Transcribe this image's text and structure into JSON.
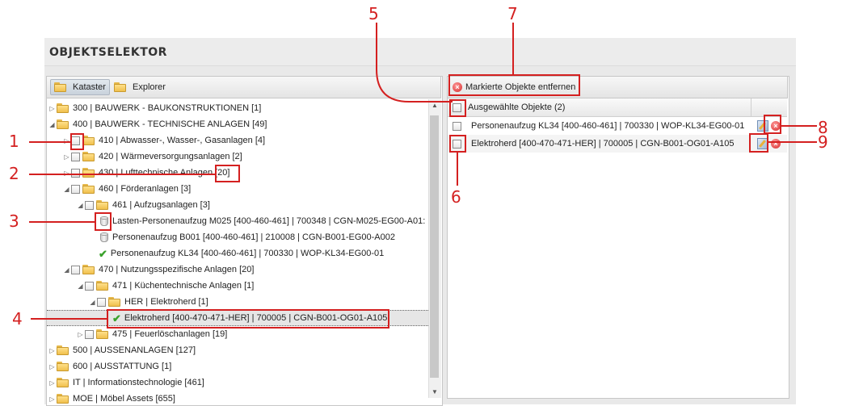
{
  "panel": {
    "title": "OBJEKTSELEKTOR"
  },
  "left": {
    "toolbar": {
      "kataster_label": "Kataster",
      "explorer_label": "Explorer"
    },
    "tree": [
      {
        "label": "300 | BAUWERK - BAUKONSTRUKTIONEN [1]"
      },
      {
        "label": "400 | BAUWERK - TECHNISCHE ANLAGEN [49]"
      },
      {
        "label": "410 | Abwasser-, Wasser-, Gasanlagen [4]"
      },
      {
        "label": "420 | Wärmeversorgungsanlagen [2]"
      },
      {
        "label": "430 | Lufttechnische Anlagen",
        "count": "[20]"
      },
      {
        "label": "460 | Förderanlagen [3]"
      },
      {
        "label": "461 | Aufzugsanlagen [3]"
      },
      {
        "label": "Lasten-Personenaufzug M025 [400-460-461] | 700348 | CGN-M025-EG00-A01:"
      },
      {
        "label": "Personenaufzug B001 [400-460-461] | 210008 | CGN-B001-EG00-A002"
      },
      {
        "label": "Personenaufzug KL34 [400-460-461] | 700330 | WOP-KL34-EG00-01"
      },
      {
        "label": "470 | Nutzungsspezifische Anlagen [20]"
      },
      {
        "label": "471 | Küchentechnische Anlagen [1]"
      },
      {
        "label": "HER | Elektroherd [1]"
      },
      {
        "label": "Elektroherd [400-470-471-HER] | 700005 | CGN-B001-OG01-A105"
      },
      {
        "label": "475 | Feuerlöschanlagen [19]"
      },
      {
        "label": "500 | AUSSENANLAGEN [127]"
      },
      {
        "label": "600 | AUSSTATTUNG [1]"
      },
      {
        "label": "IT | Informationstechnologie [461]"
      },
      {
        "label": "MOE | Möbel Assets [655]"
      }
    ]
  },
  "right": {
    "remove_label": "Markierte Objekte entfernen",
    "header_label": "Ausgewählte Objekte (2)",
    "rows": [
      {
        "label": "Personenaufzug KL34 [400-460-461] | 700330 | WOP-KL34-EG00-01"
      },
      {
        "label": "Elektroherd [400-470-471-HER] | 700005 | CGN-B001-OG01-A105"
      }
    ]
  },
  "annotations": [
    "1",
    "2",
    "3",
    "4",
    "5",
    "6",
    "7",
    "8",
    "9"
  ],
  "colors": {
    "annotation": "#d42020",
    "panel_bg": "#e9e9e9",
    "check": "#3aa12c"
  }
}
